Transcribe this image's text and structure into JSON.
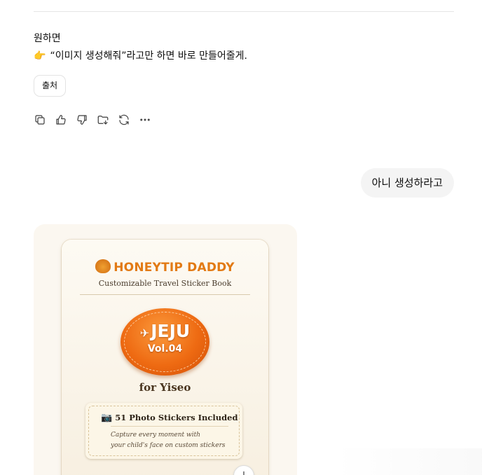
{
  "assistant_message": {
    "line1": "원하면",
    "line2_emoji": "👉",
    "line2_text": "“이미지 생성해줘”라고만 하면 바로 만들어줄게."
  },
  "source_button": {
    "label": "출처"
  },
  "action_bar": {
    "icons": [
      "copy-icon",
      "thumbs-up-icon",
      "thumbs-down-icon",
      "save-to-folder-icon",
      "regenerate-icon",
      "more-icon"
    ]
  },
  "user_message": {
    "text": "아니 생성하라고"
  },
  "generated_image": {
    "brand": "HONEYTIP DADDY",
    "subtitle": "Customizable Travel Sticker Book",
    "badge_title": "JEJU",
    "badge_volume": "Vol.04",
    "for_name": "for Yiseo",
    "info_heading": "51 Photo Stickers Included",
    "info_line1": "Capture every moment with",
    "info_line2": "your child's face on custom stickers"
  },
  "colors": {
    "brand_orange": "#e27a14",
    "badge_orange": "#ee6a12",
    "user_bubble_bg": "#f4f4f4",
    "card_bg": "#fdfaf3"
  }
}
